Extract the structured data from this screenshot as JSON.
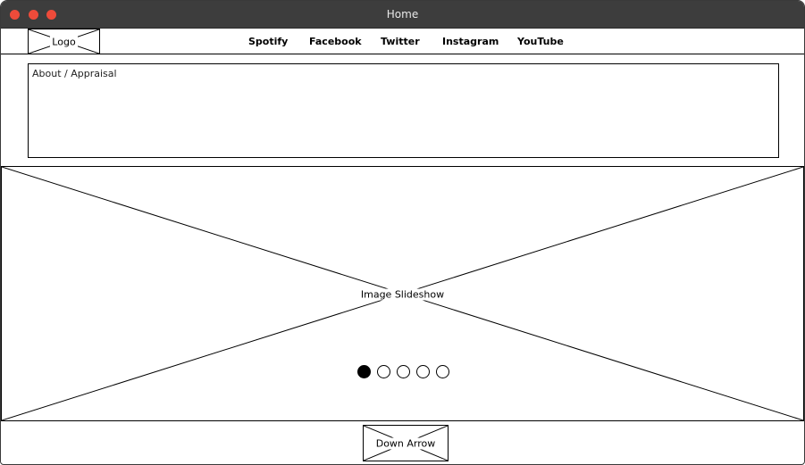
{
  "window": {
    "title": "Home"
  },
  "header": {
    "logo_label": "Logo",
    "nav_links": [
      "Spotify",
      "Facebook",
      "Twitter",
      "Instagram",
      "YouTube"
    ]
  },
  "about": {
    "label": "About / Appraisal"
  },
  "slideshow": {
    "label": "Image Slideshow",
    "slide_count": 5,
    "active_slide_index": 0
  },
  "footer": {
    "down_arrow_label": "Down Arrow"
  },
  "colors": {
    "titlebar": "#3d3d3d",
    "close_button": "#ee4b3a",
    "wireframe_line": "#000000",
    "background": "#ffffff"
  }
}
